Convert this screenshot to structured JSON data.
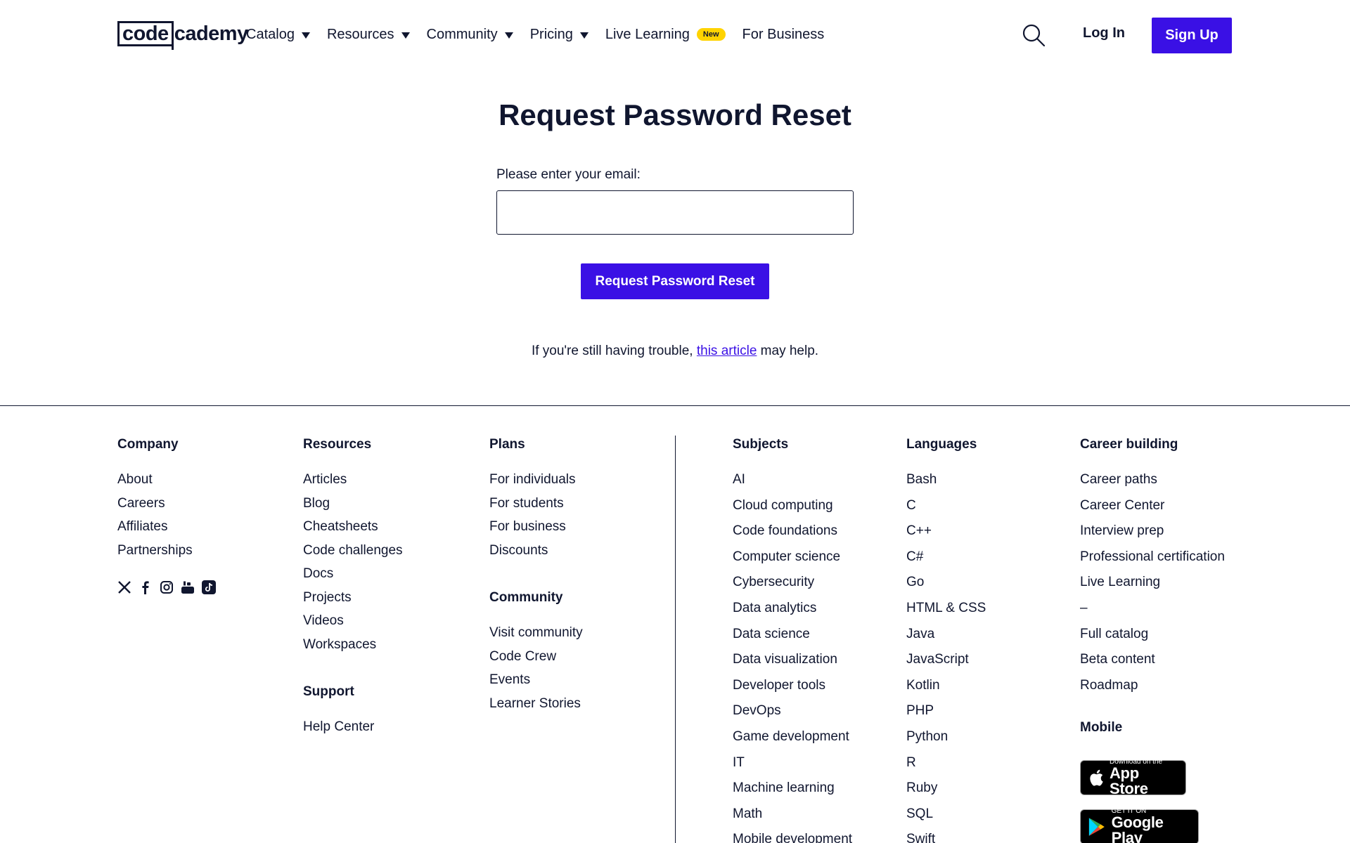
{
  "header": {
    "logo_box": "code",
    "logo_rest": "cademy",
    "nav": [
      {
        "label": "Catalog",
        "dropdown": true
      },
      {
        "label": "Resources",
        "dropdown": true
      },
      {
        "label": "Community",
        "dropdown": true
      },
      {
        "label": "Pricing",
        "dropdown": true
      },
      {
        "label": "Live Learning",
        "badge": "New"
      },
      {
        "label": "For Business"
      }
    ],
    "login_label": "Log In",
    "signup_label": "Sign Up"
  },
  "main": {
    "title": "Request Password Reset",
    "email_label": "Please enter your email:",
    "email_value": "",
    "email_placeholder": "",
    "button_label": "Request Password Reset",
    "help_prefix": "If you're still having trouble, ",
    "help_link": "this article",
    "help_suffix": " may help."
  },
  "footer": {
    "company": {
      "title": "Company",
      "items": [
        "About",
        "Careers",
        "Affiliates",
        "Partnerships"
      ]
    },
    "resources": {
      "title": "Resources",
      "items": [
        "Articles",
        "Blog",
        "Cheatsheets",
        "Code challenges",
        "Docs",
        "Projects",
        "Videos",
        "Workspaces"
      ]
    },
    "support": {
      "title": "Support",
      "items": [
        "Help Center"
      ]
    },
    "plans": {
      "title": "Plans",
      "items": [
        "For individuals",
        "For students",
        "For business",
        "Discounts"
      ]
    },
    "community": {
      "title": "Community",
      "items": [
        "Visit community",
        "Code Crew",
        "Events",
        "Learner Stories"
      ]
    },
    "subjects": {
      "title": "Subjects",
      "items": [
        "AI",
        "Cloud computing",
        "Code foundations",
        "Computer science",
        "Cybersecurity",
        "Data analytics",
        "Data science",
        "Data visualization",
        "Developer tools",
        "DevOps",
        "Game development",
        "IT",
        "Machine learning",
        "Math",
        "Mobile development"
      ]
    },
    "languages": {
      "title": "Languages",
      "items": [
        "Bash",
        "C",
        "C++",
        "C#",
        "Go",
        "HTML & CSS",
        "Java",
        "JavaScript",
        "Kotlin",
        "PHP",
        "Python",
        "R",
        "Ruby",
        "SQL",
        "Swift"
      ]
    },
    "career": {
      "title": "Career building",
      "items": [
        "Career paths",
        "Career Center",
        "Interview prep",
        "Professional certification",
        "Live Learning",
        "–",
        "Full catalog",
        "Beta content",
        "Roadmap"
      ]
    },
    "mobile": {
      "title": "Mobile",
      "app_store": {
        "small": "Download on the",
        "big": "App Store"
      },
      "google_play": {
        "small": "GET IT ON",
        "big": "Google Play"
      }
    },
    "socials": [
      "x-icon",
      "facebook-icon",
      "instagram-icon",
      "youtube-icon",
      "tiktok-icon"
    ]
  },
  "colors": {
    "primary": "#3a10e5",
    "text": "#10162f",
    "badge": "#ffd300"
  }
}
